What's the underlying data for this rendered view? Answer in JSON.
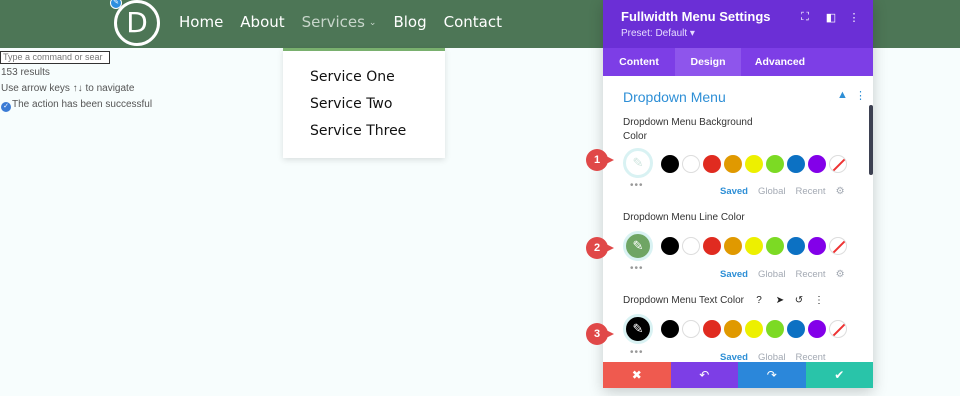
{
  "site": {
    "logo_letter": "D",
    "nav": [
      "Home",
      "About",
      "Services",
      "Blog",
      "Contact"
    ],
    "active_nav_caret": "⌄",
    "dropdown": [
      "Service One",
      "Service Two",
      "Service Three"
    ]
  },
  "command_palette": {
    "placeholder": "Type a command or sear",
    "results": "153 results",
    "hint": "Use arrow keys ↑↓ to navigate",
    "status": "The action has been successful"
  },
  "panel": {
    "title": "Fullwidth Menu Settings",
    "preset": "Preset: Default ▾",
    "tabs": [
      "Content",
      "Design",
      "Advanced"
    ],
    "active_tab": "Design",
    "section_title": "Dropdown Menu",
    "fields": [
      {
        "label": "Dropdown Menu Background Color",
        "picker_color": "#f3fbf9"
      },
      {
        "label": "Dropdown Menu Line Color",
        "picker_color": "#6fa564"
      },
      {
        "label": "Dropdown Menu Text Color",
        "picker_color": "#000000"
      }
    ],
    "swatch_colors": [
      "#000000",
      "#ffffff",
      "#e02b20",
      "#e09900",
      "#edf000",
      "#7cda24",
      "#0c71c3",
      "#8300e9"
    ],
    "subtabs": [
      "Saved",
      "Global",
      "Recent"
    ],
    "more_dots": "•••"
  },
  "annotations": [
    "1",
    "2",
    "3"
  ],
  "colors": {
    "header_green": "#4d7656",
    "panel_purple": "#6b2fd6",
    "tab_purple": "#7d3ee6",
    "accent_blue": "#2e8fd6",
    "cancel": "#ef5a4f",
    "undo": "#7d3ee6",
    "redo": "#2b87da",
    "save": "#29c4a9"
  }
}
